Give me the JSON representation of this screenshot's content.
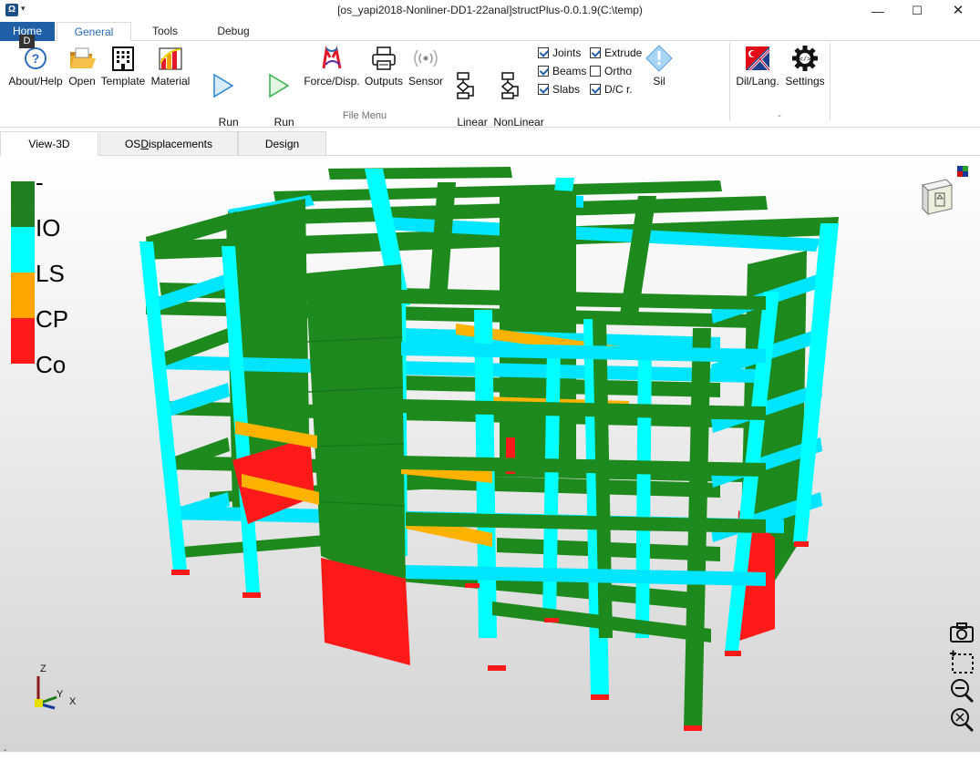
{
  "window": {
    "title": "[os_yapi2018-Nonliner-DD1-22anal]structPlus-0.0.1.9(C:\\temp)",
    "minimize": "—",
    "maximize": "☐",
    "close": "✕",
    "app_icon_glyph": "Ω",
    "qat_arrow": "▾"
  },
  "ribbon_tabs": [
    "Home",
    "General",
    "Tools",
    "Debug"
  ],
  "active_ribbon_tab": "General",
  "keytip": "D",
  "ribbon": {
    "buttons": [
      {
        "label": "About/Help",
        "icon": "help-icon"
      },
      {
        "label": "Open",
        "icon": "folder-open-icon"
      },
      {
        "label": "Template",
        "icon": "building-icon"
      },
      {
        "label": "Material",
        "icon": "material-chart-icon"
      },
      {
        "label": "Run\nOpenSees",
        "icon": "play-icon"
      },
      {
        "label": "Run\nBuild-In",
        "icon": "play-icon"
      },
      {
        "label": "Force/Disp.",
        "icon": "force-disp-icon"
      },
      {
        "label": "Outputs",
        "icon": "printer-icon"
      },
      {
        "label": "Sensor",
        "icon": "sensor-icon"
      },
      {
        "label": "Linear\nPerf.",
        "icon": "flowchart-icon"
      },
      {
        "label": "NonLinear\nPerf.",
        "icon": "flowchart-icon"
      }
    ],
    "checks": [
      {
        "label": "Joints",
        "checked": true
      },
      {
        "label": "Beams",
        "checked": true
      },
      {
        "label": "Slabs",
        "checked": true
      },
      {
        "label": "Extrude",
        "checked": true
      },
      {
        "label": "Ortho",
        "checked": false
      },
      {
        "label": "D/C r.",
        "checked": true
      }
    ],
    "sil_label": "Sil",
    "group1_label": "File Menu",
    "lang_label": "Dil/Lang.",
    "settings_label": "Settings",
    "group2_label": "-"
  },
  "doc_tabs": [
    "View-3D",
    "OSDisplacements",
    "Design"
  ],
  "doc_tab_mnemonic": {
    "prefix": "OS",
    "underlined": "D",
    "suffix": "isplacements"
  },
  "legend": {
    "entries": [
      {
        "label": "-",
        "color": "#208020"
      },
      {
        "label": "IO",
        "color": "#00ffff"
      },
      {
        "label": "LS",
        "color": "#ffa500"
      },
      {
        "label": "CP",
        "color": "#ff1a1a"
      },
      {
        "label": "Co",
        "color": ""
      }
    ]
  },
  "axes": {
    "z": "Z",
    "y": "Y",
    "x": "X"
  },
  "status_mark": "-",
  "colors": {
    "accent": "#1e5fa8",
    "io_green": "#208020",
    "ls_cyan": "#00ffff",
    "cp_orange": "#ffb300",
    "co_red": "#ff1a1a"
  },
  "viewport_tools": [
    "camera-icon",
    "select-region-icon",
    "zoom-out-icon",
    "zoom-fit-icon"
  ]
}
